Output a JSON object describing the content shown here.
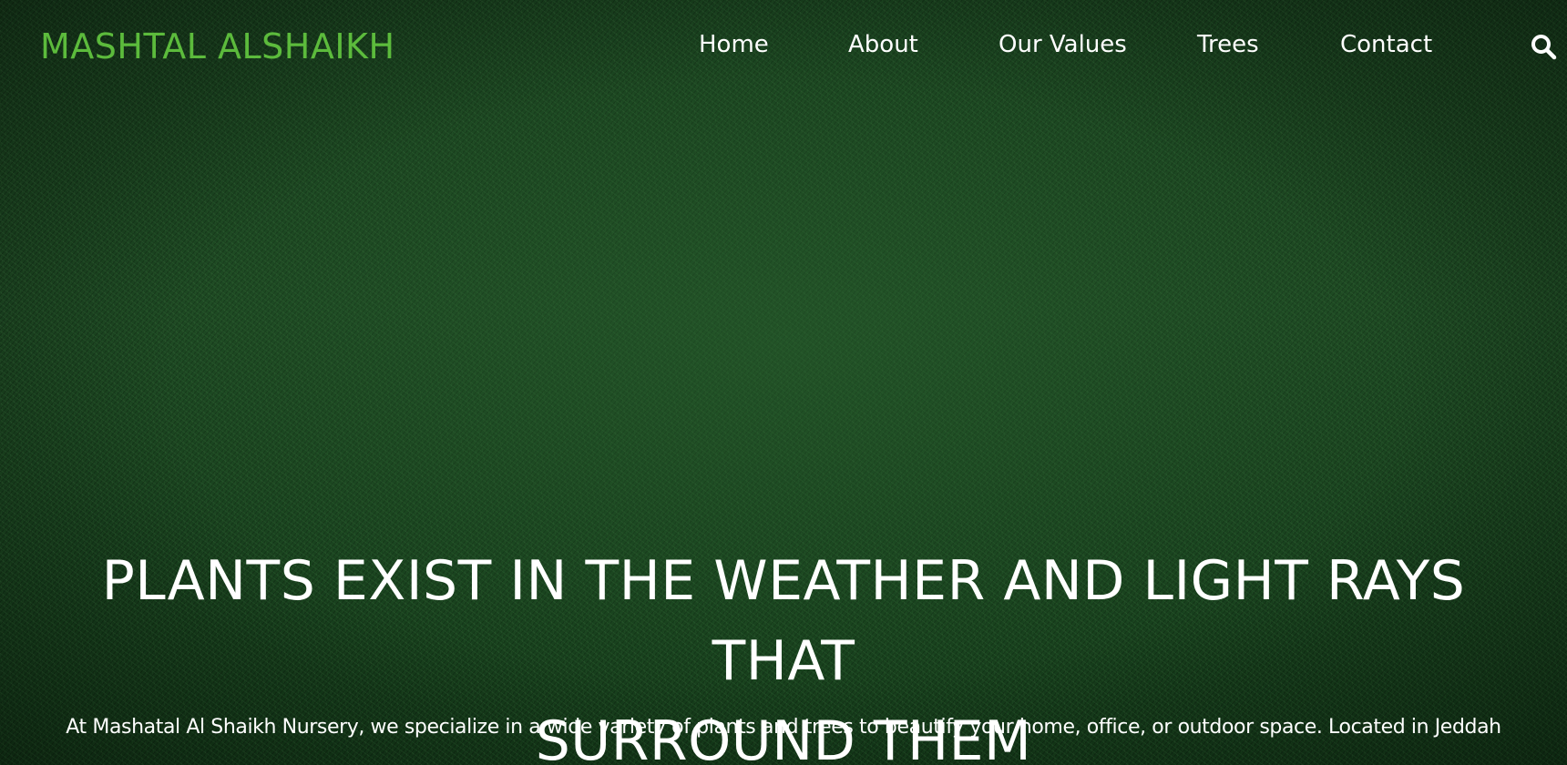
{
  "header": {
    "logo": "MASHTAL ALSHAIKH",
    "nav": {
      "home": "Home",
      "about": "About",
      "values": "Our Values",
      "trees": "Trees",
      "contact": "Contact"
    },
    "search_icon": "search-icon"
  },
  "hero": {
    "headline_line1": "PLANTS EXIST IN THE WEATHER AND LIGHT RAYS THAT",
    "headline_line2": "SURROUND THEM",
    "subtext": "At Mashatal Al Shaikh Nursery, we specialize in a wide variety of plants and trees to beautify your home, office, or outdoor space. Located in Jeddah"
  },
  "colors": {
    "logo": "#5cbb3c",
    "nav_text": "#ffffff",
    "background": "#1c4621"
  }
}
